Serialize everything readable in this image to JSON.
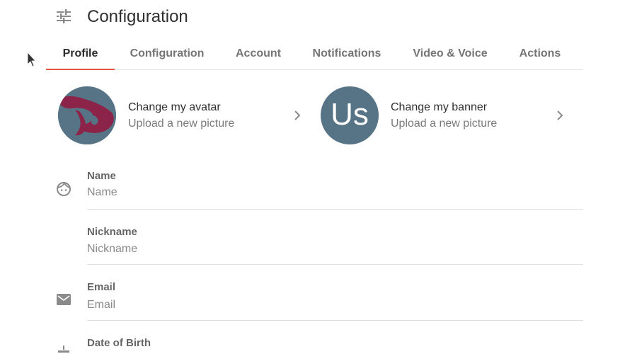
{
  "header": {
    "title": "Configuration",
    "icon": "tune-icon"
  },
  "tabs": [
    {
      "label": "Profile",
      "active": true
    },
    {
      "label": "Configuration",
      "active": false
    },
    {
      "label": "Account",
      "active": false
    },
    {
      "label": "Notifications",
      "active": false
    },
    {
      "label": "Video & Voice",
      "active": false
    },
    {
      "label": "Actions",
      "active": false
    }
  ],
  "avatar": {
    "title": "Change my avatar",
    "subtitle": "Upload a new picture"
  },
  "banner": {
    "initials": "Us",
    "title": "Change my banner",
    "subtitle": "Upload a new picture"
  },
  "fields": {
    "name": {
      "label": "Name",
      "placeholder": "Name",
      "icon": "face-icon"
    },
    "nickname": {
      "label": "Nickname",
      "placeholder": "Nickname"
    },
    "email": {
      "label": "Email",
      "placeholder": "Email",
      "icon": "mail-icon"
    },
    "dob": {
      "label": "Date of Birth",
      "icon": "cake-icon"
    }
  },
  "colors": {
    "accent": "#e8553e",
    "avatar_bg": "#577486",
    "avatar_shape": "#8c2348"
  }
}
